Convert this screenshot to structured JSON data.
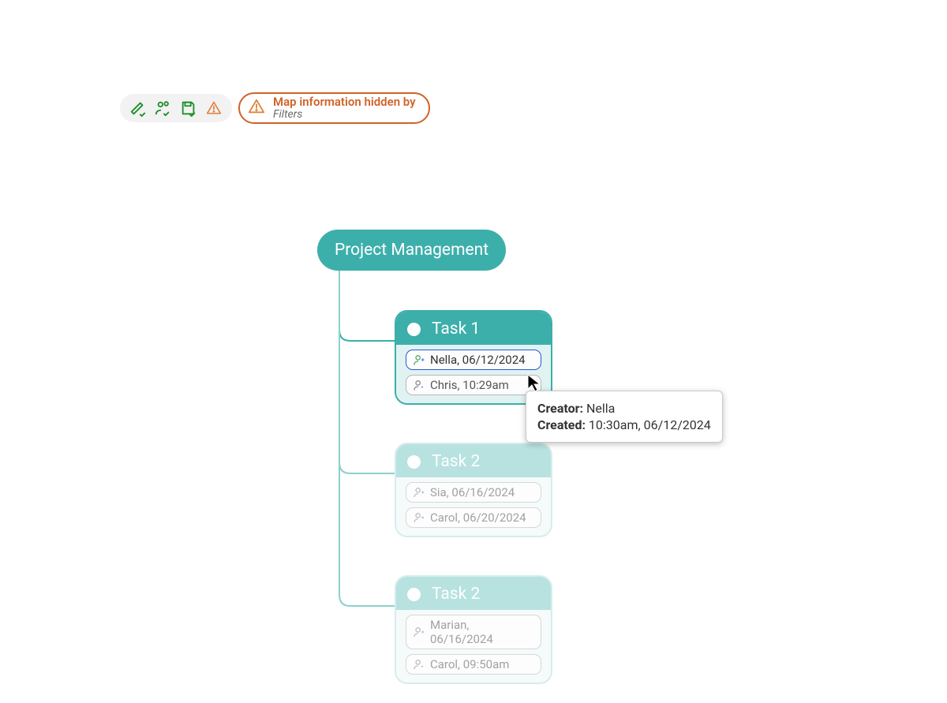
{
  "toolbar": {
    "warning": {
      "line1": "Map information hidden by",
      "line2": "Filters"
    }
  },
  "root": {
    "label": "Project Management"
  },
  "tasks": [
    {
      "title": "Task 1",
      "state": "active",
      "chips": [
        {
          "text": "Nella, 06/12/2024",
          "selected": true
        },
        {
          "text": "Chris, 10:29am",
          "selected": false
        }
      ]
    },
    {
      "title": "Task 2",
      "state": "dimmed",
      "chips": [
        {
          "text": "Sia, 06/16/2024",
          "selected": false
        },
        {
          "text": "Carol, 06/20/2024",
          "selected": false
        }
      ]
    },
    {
      "title": "Task 2",
      "state": "dimmed",
      "chips": [
        {
          "text": "Marian, 06/16/2024",
          "selected": false
        },
        {
          "text": "Carol, 09:50am",
          "selected": false
        }
      ]
    }
  ],
  "tooltip": {
    "creator_label": "Creator:",
    "creator_value": "Nella",
    "created_label": "Created:",
    "created_value": "10:30am, 06/12/2024"
  }
}
